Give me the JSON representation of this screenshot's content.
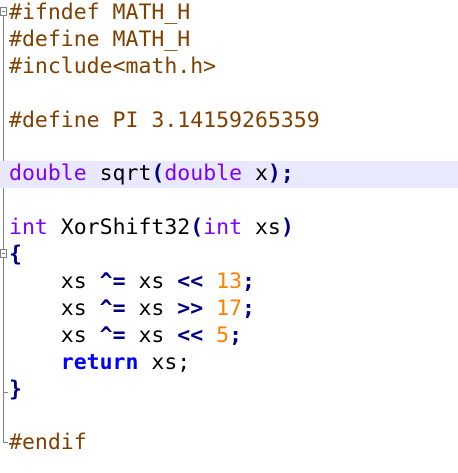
{
  "editor": {
    "language": "C",
    "current_line_color": "#e8e8ff",
    "colors": {
      "preprocessor": "#804000",
      "type_keyword": "#8000ff",
      "instruction_keyword": "#0000ff",
      "number": "#ff8000",
      "operator": "#000080",
      "identifier": "#000000"
    },
    "lines": {
      "l1": {
        "pp": "#ifndef",
        "rest": " MATH_H"
      },
      "l2": {
        "pp": "#define",
        "rest": " MATH_H"
      },
      "l3": {
        "pp": "#include",
        "rest": "<math.h>"
      },
      "l5": {
        "pp": "#define",
        "rest": " PI 3.14159265359"
      },
      "l7": {
        "t1": "double",
        "name": " sqrt",
        "open": "(",
        "t2": "double",
        "param": " x",
        "close": ")",
        "semi": ";"
      },
      "l9": {
        "t1": "int",
        "name": " XorShift32",
        "open": "(",
        "t2": "int",
        "param": " xs",
        "close": ")"
      },
      "l10": {
        "brace": "{"
      },
      "l11": {
        "indent": "    ",
        "lhs": "xs ",
        "op1": "^=",
        "mid": " xs ",
        "op2": "<<",
        "sp": " ",
        "num": "13",
        "semi": ";"
      },
      "l12": {
        "indent": "    ",
        "lhs": "xs ",
        "op1": "^=",
        "mid": " xs ",
        "op2": ">>",
        "sp": " ",
        "num": "17",
        "semi": ";"
      },
      "l13": {
        "indent": "    ",
        "lhs": "xs ",
        "op1": "^=",
        "mid": " xs ",
        "op2": "<<",
        "sp": " ",
        "num": "5",
        "semi": ";"
      },
      "l14": {
        "indent": "    ",
        "kw": "return",
        "rest": " xs;"
      },
      "l15": {
        "brace": "}"
      },
      "l17": {
        "pp": "#endif"
      }
    }
  }
}
